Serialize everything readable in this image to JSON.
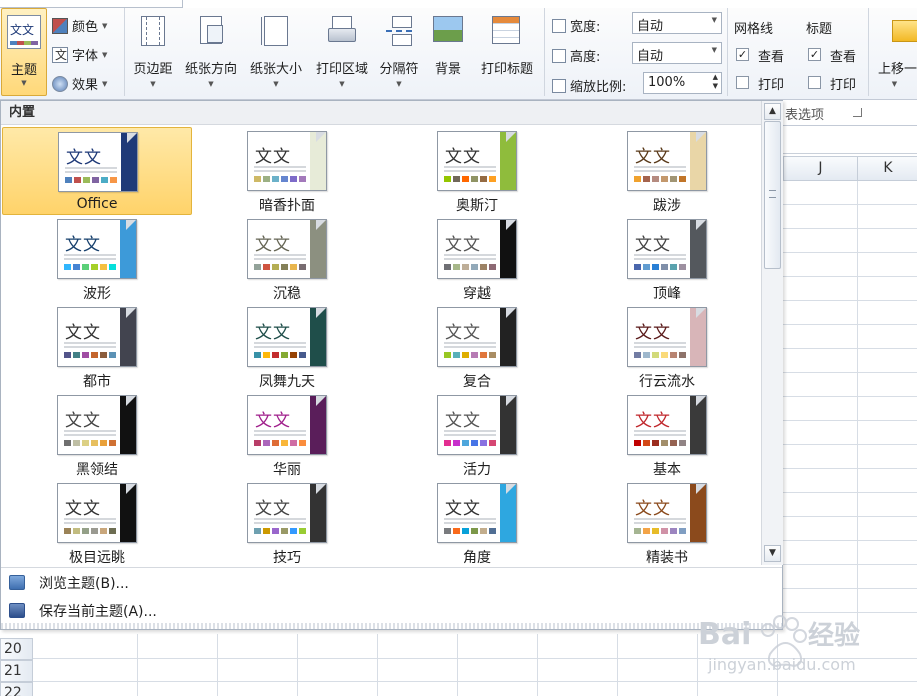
{
  "ribbon": {
    "theme_button": {
      "label": "主题",
      "icon_text": "文文"
    },
    "theme_small": [
      {
        "label": "颜色",
        "icon": "color-icon"
      },
      {
        "label": "字体",
        "icon": "font-icon"
      },
      {
        "label": "效果",
        "icon": "effects-icon"
      }
    ],
    "page_setup": [
      {
        "label": "页边距",
        "icon": "margins-icon"
      },
      {
        "label": "纸张方向",
        "icon": "orientation-icon"
      },
      {
        "label": "纸张大小",
        "icon": "paper-size-icon"
      },
      {
        "label": "打印区域",
        "icon": "print-area-icon"
      },
      {
        "label": "分隔符",
        "icon": "breaks-icon"
      },
      {
        "label": "背景",
        "icon": "background-icon"
      },
      {
        "label": "打印标题",
        "icon": "print-titles-icon"
      }
    ],
    "scale": {
      "width_label": "宽度:",
      "width_value": "自动",
      "height_label": "高度:",
      "height_value": "自动",
      "zoom_label": "缩放比例:",
      "zoom_value": "100%"
    },
    "gridlines": {
      "title": "网格线",
      "view_label": "查看",
      "view_checked": true,
      "print_label": "打印",
      "print_checked": false
    },
    "headings": {
      "title": "标题",
      "view_label": "查看",
      "view_checked": true,
      "print_label": "打印",
      "print_checked": false
    },
    "sheet_options_label": "表选项",
    "bring_forward_label": "上移一"
  },
  "sheet": {
    "columns": [
      "J",
      "K"
    ],
    "rows": [
      "20",
      "21",
      "22"
    ]
  },
  "panel": {
    "header": "内置",
    "themes": [
      {
        "name": "Office",
        "selected": true,
        "band": "#1f3a78",
        "text_color": "#1f3a78",
        "swatches": [
          "#4f81bd",
          "#c0504d",
          "#9bbb59",
          "#8064a2",
          "#4bacc6",
          "#f79646"
        ]
      },
      {
        "name": "暗香扑面",
        "selected": false,
        "band": "#e7ebd8",
        "text_color": "#333333",
        "swatches": [
          "#ceb966",
          "#9cb084",
          "#6bb1c9",
          "#6585cf",
          "#7e6bc9",
          "#a379bb"
        ]
      },
      {
        "name": "奥斯汀",
        "selected": false,
        "band": "#8fbc3c",
        "text_color": "#333333",
        "swatches": [
          "#94c600",
          "#71685a",
          "#ff6700",
          "#909465",
          "#956b43",
          "#fea022"
        ]
      },
      {
        "name": "跋涉",
        "selected": false,
        "band": "#e9d6a7",
        "text_color": "#5a3a1a",
        "swatches": [
          "#f0a22e",
          "#a5644e",
          "#b58b80",
          "#c3986d",
          "#a19574",
          "#c17529"
        ]
      },
      {
        "name": "波形",
        "selected": false,
        "band": "#3d9ad9",
        "text_color": "#17406d",
        "swatches": [
          "#31b6fd",
          "#4584d3",
          "#5bd078",
          "#a5d028",
          "#f5c040",
          "#05e0db"
        ]
      },
      {
        "name": "沉稳",
        "selected": false,
        "band": "#8c9080",
        "text_color": "#666655",
        "swatches": [
          "#93a299",
          "#cf543f",
          "#b5ae53",
          "#848058",
          "#e8b54d",
          "#786c71"
        ]
      },
      {
        "name": "穿越",
        "selected": false,
        "band": "#111111",
        "text_color": "#555555",
        "swatches": [
          "#6f6f74",
          "#a7b789",
          "#beae98",
          "#92a9b9",
          "#9c8265",
          "#8d6974"
        ]
      },
      {
        "name": "顶峰",
        "selected": false,
        "band": "#54585d",
        "text_color": "#444444",
        "swatches": [
          "#4a66ac",
          "#629dd1",
          "#297fd5",
          "#7f8fa9",
          "#5aa2ae",
          "#9d90a0"
        ]
      },
      {
        "name": "都市",
        "selected": false,
        "band": "#42444f",
        "text_color": "#333333",
        "swatches": [
          "#53548a",
          "#438086",
          "#a04da3",
          "#c4652d",
          "#8b5d3d",
          "#5c92b5"
        ]
      },
      {
        "name": "凤舞九天",
        "selected": false,
        "band": "#1f4e4a",
        "text_color": "#1f4e4a",
        "swatches": [
          "#3891a7",
          "#feb80a",
          "#c32d2e",
          "#84aa33",
          "#964305",
          "#475a8d"
        ]
      },
      {
        "name": "复合",
        "selected": false,
        "band": "#222222",
        "text_color": "#555555",
        "swatches": [
          "#98c723",
          "#59b0b9",
          "#deae00",
          "#b77bb4",
          "#e0773c",
          "#a98d63"
        ]
      },
      {
        "name": "行云流水",
        "selected": false,
        "band": "#d8b5b8",
        "text_color": "#5a1a1a",
        "swatches": [
          "#727ca3",
          "#9fb8cd",
          "#d2da7a",
          "#fada7a",
          "#b88472",
          "#8e736a"
        ]
      },
      {
        "name": "黑领结",
        "selected": false,
        "band": "#111111",
        "text_color": "#444444",
        "swatches": [
          "#6f6f6f",
          "#bfbfa5",
          "#dcd084",
          "#e7bf5f",
          "#e9a039",
          "#cf7133"
        ]
      },
      {
        "name": "华丽",
        "selected": false,
        "band": "#5a1e5a",
        "text_color": "#a0208c",
        "swatches": [
          "#b83d68",
          "#ac66bb",
          "#de6c36",
          "#f9b639",
          "#cf6da4",
          "#fa8d3d"
        ]
      },
      {
        "name": "活力",
        "selected": false,
        "band": "#333333",
        "text_color": "#555555",
        "swatches": [
          "#e32d91",
          "#c830cc",
          "#4ea6dc",
          "#4775e7",
          "#8971e1",
          "#d54773"
        ]
      },
      {
        "name": "基本",
        "selected": false,
        "band": "#3a3a3a",
        "text_color": "#c0282d",
        "swatches": [
          "#c00000",
          "#d34817",
          "#9b2d1f",
          "#a28e6a",
          "#956251",
          "#918485"
        ]
      },
      {
        "name": "极目远眺",
        "selected": false,
        "band": "#111111",
        "text_color": "#333333",
        "swatches": [
          "#9b8357",
          "#c2bc80",
          "#94a088",
          "#9a9a91",
          "#c9a77c",
          "#6d6d52"
        ]
      },
      {
        "name": "技巧",
        "selected": false,
        "band": "#333333",
        "text_color": "#444444",
        "swatches": [
          "#6ea0b0",
          "#cc9900",
          "#9966cc",
          "#999966",
          "#3399ff",
          "#99cc33"
        ]
      },
      {
        "name": "角度",
        "selected": false,
        "band": "#2ea7e0",
        "text_color": "#333333",
        "swatches": [
          "#797b7e",
          "#f96a1b",
          "#08a1d9",
          "#7c984a",
          "#c2ad8d",
          "#506e94"
        ]
      },
      {
        "name": "精装书",
        "selected": false,
        "band": "#8b4a1c",
        "text_color": "#8b4a1c",
        "swatches": [
          "#a5b592",
          "#f3a447",
          "#e7bc29",
          "#d092a7",
          "#9c85c0",
          "#809ec2"
        ]
      }
    ],
    "menu": [
      {
        "label": "浏览主题(B)...",
        "icon": "browse-theme-icon"
      },
      {
        "label": "保存当前主题(A)...",
        "icon": "save-theme-icon"
      }
    ]
  }
}
